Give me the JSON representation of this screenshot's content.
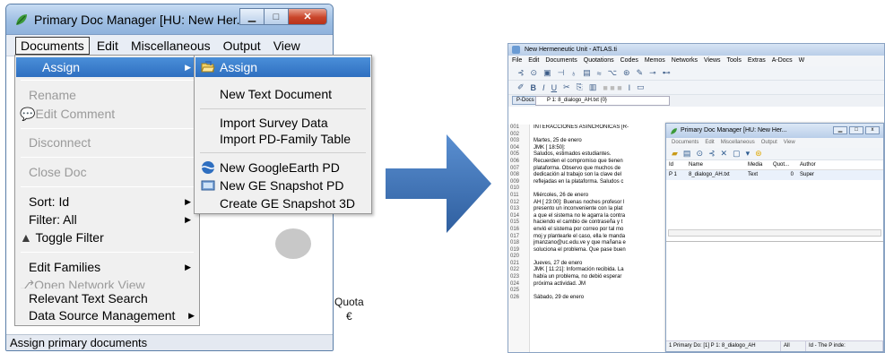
{
  "left_window": {
    "title": "Primary Doc Manager [HU: New Her...",
    "menubar": [
      "Documents",
      "Edit",
      "Miscellaneous",
      "Output",
      "View"
    ],
    "documents_menu": [
      {
        "label": "Assign",
        "state": "highlighted",
        "submenu": true
      },
      {
        "label": "Rename",
        "state": "disabled"
      },
      {
        "label": "Edit Comment",
        "state": "disabled"
      },
      {
        "label": "Disconnect",
        "state": "disabled"
      },
      {
        "label": "Close Doc",
        "state": "disabled"
      },
      {
        "label": "Sort: Id",
        "state": "enabled",
        "submenu": true
      },
      {
        "label": "Filter: All",
        "state": "enabled",
        "submenu": true
      },
      {
        "label": "Toggle Filter",
        "state": "enabled"
      },
      {
        "label": "Edit Families",
        "state": "enabled",
        "submenu": true
      },
      {
        "label": "Open Network View",
        "state": "disabled"
      },
      {
        "label": "Relevant Text Search",
        "state": "enabled"
      },
      {
        "label": "Data Source Management",
        "state": "enabled",
        "submenu": true
      }
    ],
    "assign_submenu": [
      {
        "label": "Assign",
        "icon": "folder-open-icon",
        "state": "highlighted"
      },
      {
        "label": "New Text Document"
      },
      {
        "label": "Import Survey Data"
      },
      {
        "label": "Import PD-Family Table"
      },
      {
        "label": "New GoogleEarth PD",
        "icon": "globe-icon"
      },
      {
        "label": "New GE Snapshot PD",
        "icon": "snapshot-icon"
      },
      {
        "label": "Create GE Snapshot 3D"
      }
    ],
    "status": "Assign primary documents",
    "background_fragment": {
      "quota": "Quota",
      "c": "€"
    }
  },
  "right_window": {
    "title": "New Hermeneutic Unit - ATLAS.ti",
    "menubar": [
      "File",
      "Edit",
      "Documents",
      "Quotations",
      "Codes",
      "Memos",
      "Networks",
      "Views",
      "Tools",
      "Extras",
      "A-Docs",
      "W"
    ],
    "pdoc_button": "P-Docs",
    "pdoc_selected": "P 1: 8_dialogo_AH.txt {0}",
    "line_numbers": [
      "001",
      "002",
      "003",
      "004",
      "005",
      "006",
      "007",
      "008",
      "009",
      "010",
      "011",
      "012",
      "013",
      "014",
      "015",
      "016",
      "017",
      "018",
      "019",
      "020",
      "021",
      "022",
      "023",
      "024",
      "025",
      "026"
    ],
    "text_lines": [
      "INTERACCIONES ASINCRÓNICAS [R-",
      "",
      "Martes, 25 de enero",
      "JMK [ 18:50]:",
      "Saludos, estimados estudiantes.",
      "Recuerden el compromiso que tienen",
      "plataforma. Observo que muchos de",
      "dedicación al trabajo son la clave del",
      "reflejadas en la plataforma. Saludos c",
      "",
      "Miércoles, 26 de enero",
      "AH [ 23:00]: Buenas noches profesor l",
      "presento un inconveniente con la plat",
      "a que el sistema no le agarra la contra",
      "haciendo el cambio de contraseña y t",
      "envió el sistema por correo por tal mo",
      "moj y plantearle el caso, ella le manda",
      "jmanzano@uc.edu.ve y que mañana e",
      "soluciona el problema. Que pase buen",
      "",
      "Jueves, 27 de enero",
      "JMK [ 11:21]: Información recibida. La",
      "había un problema, no debió esperar",
      "próxima actividad. JM",
      "",
      "Sábado, 29 de enero"
    ],
    "pdm": {
      "title": "Primary Doc Manager [HU: New Her...",
      "menubar": [
        "Documents",
        "Edit",
        "Miscellaneous",
        "Output",
        "View"
      ],
      "columns": [
        "Id",
        "Name",
        "Media",
        "Quot...",
        "Author"
      ],
      "rows": [
        {
          "id": "P 1",
          "name": "8_dialogo_AH.txt",
          "media": "Text",
          "quot": "0",
          "author": "Super"
        }
      ],
      "status": [
        "1 Primary Do: [1] P 1: 8_dialogo_AH",
        "All",
        "Id - The P inde:"
      ]
    }
  },
  "colors": {
    "highlight": "#3a7fd0",
    "arrow": "#3f74b9",
    "titlebar": "#a9c6e8",
    "close": "#c9452a"
  }
}
